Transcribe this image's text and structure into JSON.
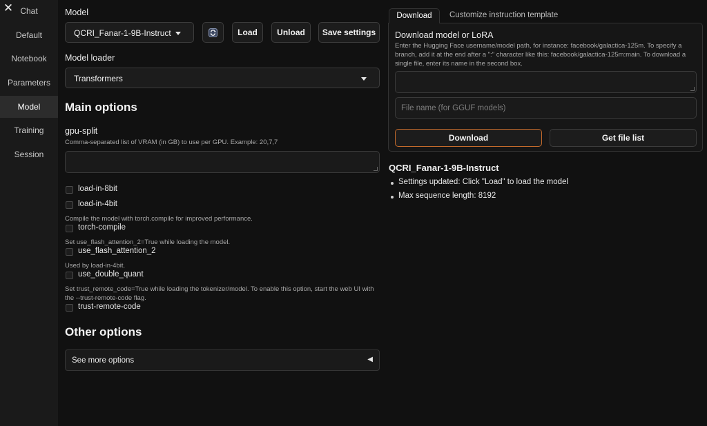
{
  "sidebar": {
    "close_icon": "✕",
    "items": [
      {
        "label": "Chat"
      },
      {
        "label": "Default"
      },
      {
        "label": "Notebook"
      },
      {
        "label": "Parameters"
      },
      {
        "label": "Model"
      },
      {
        "label": "Training"
      },
      {
        "label": "Session"
      }
    ],
    "active": "Model"
  },
  "model_section": {
    "label": "Model",
    "selected_model": "QCRI_Fanar-1-9B-Instruct",
    "refresh_icon": "refresh-icon",
    "load_label": "Load",
    "unload_label": "Unload",
    "save_settings_label": "Save settings"
  },
  "loader_section": {
    "label": "Model loader",
    "selected_loader": "Transformers"
  },
  "main_options": {
    "heading": "Main options",
    "gpu_split": {
      "label": "gpu-split",
      "hint": "Comma-separated list of VRAM (in GB) to use per GPU. Example: 20,7,7",
      "value": ""
    },
    "checkboxes": {
      "load_in_8bit": {
        "label": "load-in-8bit",
        "checked": false
      },
      "load_in_4bit": {
        "label": "load-in-4bit",
        "checked": false
      },
      "torch_compile": {
        "hint": "Compile the model with torch.compile for improved performance.",
        "label": "torch-compile",
        "checked": false
      },
      "use_flash_attention_2": {
        "hint": "Set use_flash_attention_2=True while loading the model.",
        "label": "use_flash_attention_2",
        "checked": false
      },
      "use_double_quant": {
        "hint": "Used by load-in-4bit.",
        "label": "use_double_quant",
        "checked": false
      },
      "trust_remote_code": {
        "hint": "Set trust_remote_code=True while loading the tokenizer/model. To enable this option, start the web UI with the --trust-remote-code flag.",
        "label": "trust-remote-code",
        "checked": false
      }
    }
  },
  "other_options": {
    "heading": "Other options",
    "accordion_label": "See more options",
    "accordion_icon": "◀"
  },
  "right_panel": {
    "tabs": [
      {
        "label": "Download"
      },
      {
        "label": "Customize instruction template"
      }
    ],
    "download": {
      "title": "Download model or LoRA",
      "description": "Enter the Hugging Face username/model path, for instance: facebook/galactica-125m. To specify a branch, add it at the end after a \":\" character like this: facebook/galactica-125m:main. To download a single file, enter its name in the second box.",
      "path_value": "",
      "filename_placeholder": "File name (for GGUF models)",
      "download_label": "Download",
      "file_list_label": "Get file list"
    },
    "status": {
      "model_name": "QCRI_Fanar-1-9B-Instruct",
      "items": [
        "Settings updated: Click \"Load\" to load the model",
        "Max sequence length: 8192"
      ]
    }
  },
  "colors": {
    "background": "#111111",
    "accent_border": "#c46a2b"
  }
}
